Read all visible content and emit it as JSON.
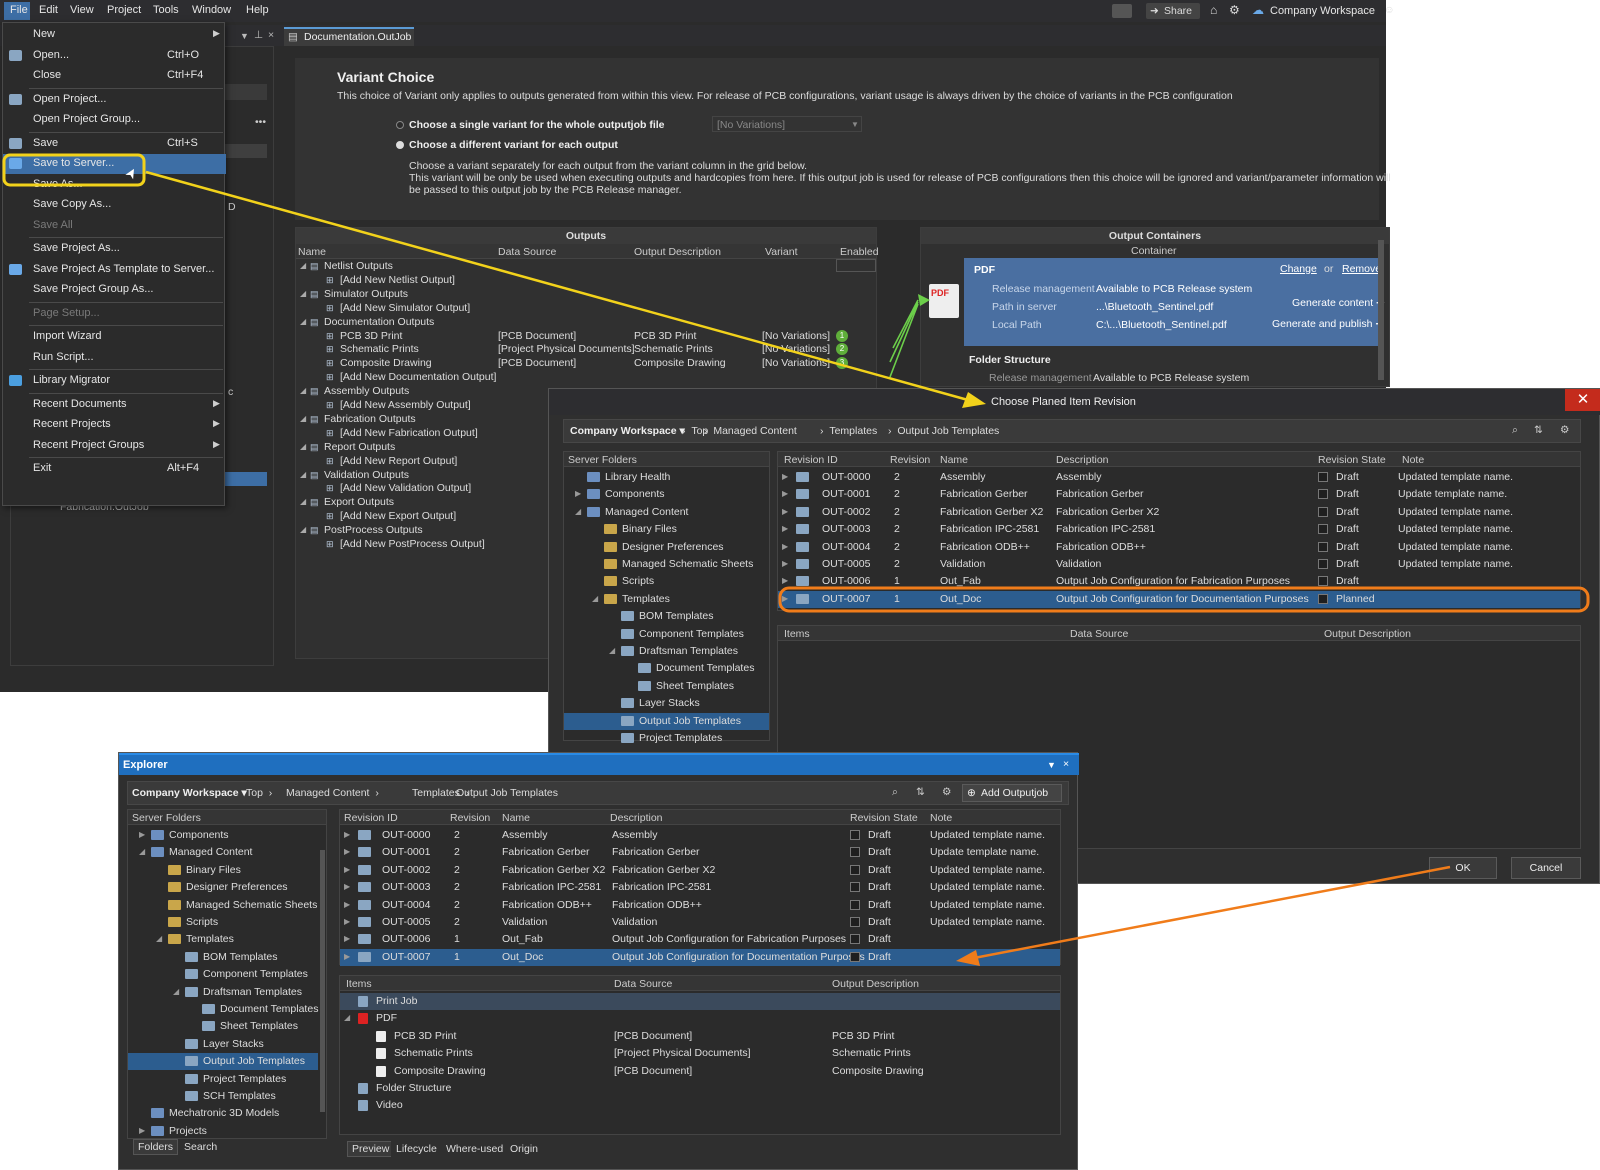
{
  "menubar": {
    "items": [
      "File",
      "Edit",
      "View",
      "Project",
      "Tools",
      "Window",
      "Help"
    ],
    "share": "Share",
    "workspace": "Company Workspace"
  },
  "doc_tab": "Documentation.OutJob",
  "file_menu": [
    {
      "label": "New",
      "shortcut": "",
      "sub": true
    },
    {
      "label": "Open...",
      "shortcut": "Ctrl+O"
    },
    {
      "label": "Close",
      "shortcut": "Ctrl+F4"
    },
    {
      "label": "Open Project...",
      "shortcut": ""
    },
    {
      "label": "Open Project Group...",
      "shortcut": ""
    },
    {
      "label": "Save",
      "shortcut": "Ctrl+S"
    },
    {
      "label": "Save to Server...",
      "shortcut": ""
    },
    {
      "label": "Save As...",
      "shortcut": ""
    },
    {
      "label": "Save Copy As...",
      "shortcut": ""
    },
    {
      "label": "Save All",
      "shortcut": "",
      "disabled": true
    },
    {
      "label": "Save Project As...",
      "shortcut": ""
    },
    {
      "label": "Save Project As Template to Server...",
      "shortcut": ""
    },
    {
      "label": "Save Project Group As...",
      "shortcut": ""
    },
    {
      "label": "Page Setup...",
      "shortcut": "",
      "disabled": true
    },
    {
      "label": "Import Wizard",
      "shortcut": ""
    },
    {
      "label": "Run Script...",
      "shortcut": ""
    },
    {
      "label": "Library Migrator",
      "shortcut": ""
    },
    {
      "label": "Recent Documents",
      "shortcut": "",
      "sub": true
    },
    {
      "label": "Recent Projects",
      "shortcut": "",
      "sub": true
    },
    {
      "label": "Recent Project Groups",
      "shortcut": "",
      "sub": true
    },
    {
      "label": "Exit",
      "shortcut": "Alt+F4"
    }
  ],
  "left_remnants": {
    "fab_outjob": "Fabrication.OutJob",
    "d_letter": "D",
    "c_letter": "c"
  },
  "variant": {
    "title": "Variant Choice",
    "desc": "This choice of Variant only applies to outputs generated from within this view. For release of PCB configurations, variant usage is always driven by the choice of variants in the PCB configuration",
    "opt1": "Choose a single variant for the whole outputjob file",
    "opt1_value": "[No Variations]",
    "opt2": "Choose a different variant for each output",
    "note1": "Choose a variant separately for each output from the variant column in the grid below.",
    "note2": "This variant will be only be used when executing outputs and hardcopies from here. If this output job is used for release of PCB configurations then this choice will be ignored and variant/parameter information will",
    "note3": "be passed to this output job by the PCB Release manager."
  },
  "outputs": {
    "title": "Outputs",
    "columns": [
      "Name",
      "Data Source",
      "Output Description",
      "Variant",
      "Enabled"
    ],
    "rows": [
      {
        "level": 0,
        "name": "Netlist Outputs"
      },
      {
        "level": 1,
        "name": "[Add New Netlist Output]"
      },
      {
        "level": 0,
        "name": "Simulator Outputs"
      },
      {
        "level": 1,
        "name": "[Add New Simulator Output]"
      },
      {
        "level": 0,
        "name": "Documentation Outputs"
      },
      {
        "level": 1,
        "name": "PCB 3D Print",
        "src": "[PCB Document]",
        "desc": "PCB 3D Print",
        "var": "[No Variations]",
        "num": "1"
      },
      {
        "level": 1,
        "name": "Schematic Prints",
        "src": "[Project Physical Documents]",
        "desc": "Schematic Prints",
        "var": "[No Variations]",
        "num": "2"
      },
      {
        "level": 1,
        "name": "Composite Drawing",
        "src": "[PCB Document]",
        "desc": "Composite Drawing",
        "var": "[No Variations]",
        "num": "3"
      },
      {
        "level": 1,
        "name": "[Add New Documentation Output]"
      },
      {
        "level": 0,
        "name": "Assembly Outputs"
      },
      {
        "level": 1,
        "name": "[Add New Assembly Output]"
      },
      {
        "level": 0,
        "name": "Fabrication Outputs"
      },
      {
        "level": 1,
        "name": "[Add New Fabrication Output]"
      },
      {
        "level": 0,
        "name": "Report Outputs"
      },
      {
        "level": 1,
        "name": "[Add New Report Output]"
      },
      {
        "level": 0,
        "name": "Validation Outputs"
      },
      {
        "level": 1,
        "name": "[Add New Validation Output]"
      },
      {
        "level": 0,
        "name": "Export Outputs"
      },
      {
        "level": 1,
        "name": "[Add New Export Output]"
      },
      {
        "level": 0,
        "name": "PostProcess Outputs"
      },
      {
        "level": 1,
        "name": "[Add New PostProcess Output]"
      }
    ]
  },
  "containers": {
    "title": "Output Containers",
    "col": "Container",
    "pdf": "PDF",
    "change": "Change",
    "or": "or",
    "remove": "Remove",
    "rm_label": "Release management",
    "rm_value": "Available to PCB Release system",
    "ps_label": "Path in server",
    "ps_value": "...\\Bluetooth_Sentinel.pdf",
    "lp_label": "Local Path",
    "lp_value": "C:\\...\\Bluetooth_Sentinel.pdf",
    "gen": "Generate content",
    "genpub": "Generate and publish",
    "folder": "Folder Structure",
    "frm_label": "Release management",
    "frm_value": "Available to PCB Release system"
  },
  "dialog": {
    "title": "Choose Planed Item Revision",
    "breadcrumb": [
      "Company Workspace",
      "Top",
      "Managed Content",
      "Templates",
      "Output Job Templates"
    ],
    "tree_header": "Server Folders",
    "tree": [
      {
        "label": "Library Health",
        "lvl": 1
      },
      {
        "label": "Components",
        "lvl": 1
      },
      {
        "label": "Managed Content",
        "lvl": 1
      },
      {
        "label": "Binary Files",
        "lvl": 2
      },
      {
        "label": "Designer Preferences",
        "lvl": 2
      },
      {
        "label": "Managed Schematic Sheets",
        "lvl": 2
      },
      {
        "label": "Scripts",
        "lvl": 2
      },
      {
        "label": "Templates",
        "lvl": 2
      },
      {
        "label": "BOM Templates",
        "lvl": 3
      },
      {
        "label": "Component Templates",
        "lvl": 3
      },
      {
        "label": "Draftsman Templates",
        "lvl": 3
      },
      {
        "label": "Document Templates",
        "lvl": 4
      },
      {
        "label": "Sheet Templates",
        "lvl": 4
      },
      {
        "label": "Layer Stacks",
        "lvl": 3
      },
      {
        "label": "Output Job Templates",
        "lvl": 3,
        "sel": true
      },
      {
        "label": "Project Templates",
        "lvl": 3
      }
    ],
    "columns": [
      "Revision ID",
      "Revision",
      "Name",
      "Description",
      "Revision State",
      "Note"
    ],
    "rows": [
      {
        "id": "OUT-0000",
        "rev": "2",
        "name": "Assembly",
        "desc": "Assembly",
        "state": "Draft",
        "note": "Updated template name."
      },
      {
        "id": "OUT-0001",
        "rev": "2",
        "name": "Fabrication Gerber",
        "desc": "Fabrication Gerber",
        "state": "Draft",
        "note": "Update template name."
      },
      {
        "id": "OUT-0002",
        "rev": "2",
        "name": "Fabrication Gerber X2",
        "desc": "Fabrication Gerber X2",
        "state": "Draft",
        "note": "Updated template name."
      },
      {
        "id": "OUT-0003",
        "rev": "2",
        "name": "Fabrication IPC-2581",
        "desc": "Fabrication IPC-2581",
        "state": "Draft",
        "note": "Updated template name."
      },
      {
        "id": "OUT-0004",
        "rev": "2",
        "name": "Fabrication ODB++",
        "desc": "Fabrication ODB++",
        "state": "Draft",
        "note": "Updated template name."
      },
      {
        "id": "OUT-0005",
        "rev": "2",
        "name": "Validation",
        "desc": "Validation",
        "state": "Draft",
        "note": "Updated template name."
      },
      {
        "id": "OUT-0006",
        "rev": "1",
        "name": "Out_Fab",
        "desc": "Output Job Configuration for Fabrication Purposes",
        "state": "Draft",
        "note": ""
      },
      {
        "id": "OUT-0007",
        "rev": "1",
        "name": "Out_Doc",
        "desc": "Output Job Configuration for Documentation Purposes",
        "state": "Planned",
        "note": "",
        "sel": true
      }
    ],
    "items_columns": [
      "Items",
      "Data Source",
      "Output Description"
    ],
    "ok": "OK",
    "cancel": "Cancel"
  },
  "explorer": {
    "title": "Explorer",
    "breadcrumb": [
      "Company Workspace",
      "Top",
      "Managed Content",
      "Templates",
      "Output Job Templates"
    ],
    "add_button": "Add Outputjob",
    "tree_header": "Server Folders",
    "tree": [
      {
        "label": "Components",
        "lvl": 1
      },
      {
        "label": "Managed Content",
        "lvl": 1
      },
      {
        "label": "Binary Files",
        "lvl": 2
      },
      {
        "label": "Designer Preferences",
        "lvl": 2
      },
      {
        "label": "Managed Schematic Sheets",
        "lvl": 2
      },
      {
        "label": "Scripts",
        "lvl": 2
      },
      {
        "label": "Templates",
        "lvl": 2
      },
      {
        "label": "BOM Templates",
        "lvl": 3
      },
      {
        "label": "Component Templates",
        "lvl": 3
      },
      {
        "label": "Draftsman Templates",
        "lvl": 3
      },
      {
        "label": "Document Templates",
        "lvl": 4
      },
      {
        "label": "Sheet Templates",
        "lvl": 4
      },
      {
        "label": "Layer Stacks",
        "lvl": 3
      },
      {
        "label": "Output Job Templates",
        "lvl": 3,
        "sel": true
      },
      {
        "label": "Project Templates",
        "lvl": 3
      },
      {
        "label": "SCH Templates",
        "lvl": 3
      },
      {
        "label": "Mechatronic 3D Models",
        "lvl": 1
      },
      {
        "label": "Projects",
        "lvl": 1
      }
    ],
    "columns": [
      "Revision ID",
      "Revision",
      "Name",
      "Description",
      "Revision State",
      "Note"
    ],
    "rows": [
      {
        "id": "OUT-0000",
        "rev": "2",
        "name": "Assembly",
        "desc": "Assembly",
        "state": "Draft",
        "note": "Updated template name."
      },
      {
        "id": "OUT-0001",
        "rev": "2",
        "name": "Fabrication Gerber",
        "desc": "Fabrication Gerber",
        "state": "Draft",
        "note": "Update template name."
      },
      {
        "id": "OUT-0002",
        "rev": "2",
        "name": "Fabrication Gerber X2",
        "desc": "Fabrication Gerber X2",
        "state": "Draft",
        "note": "Updated template name."
      },
      {
        "id": "OUT-0003",
        "rev": "2",
        "name": "Fabrication IPC-2581",
        "desc": "Fabrication IPC-2581",
        "state": "Draft",
        "note": "Updated template name."
      },
      {
        "id": "OUT-0004",
        "rev": "2",
        "name": "Fabrication ODB++",
        "desc": "Fabrication ODB++",
        "state": "Draft",
        "note": "Updated template name."
      },
      {
        "id": "OUT-0005",
        "rev": "2",
        "name": "Validation",
        "desc": "Validation",
        "state": "Draft",
        "note": "Updated template name."
      },
      {
        "id": "OUT-0006",
        "rev": "1",
        "name": "Out_Fab",
        "desc": "Output Job Configuration for Fabrication Purposes",
        "state": "Draft",
        "note": ""
      },
      {
        "id": "OUT-0007",
        "rev": "1",
        "name": "Out_Doc",
        "desc": "Output Job Configuration for Documentation Purposes",
        "state": "Draft",
        "note": "",
        "sel": true
      }
    ],
    "items_columns": [
      "Items",
      "Data Source",
      "Output Description"
    ],
    "items": [
      {
        "label": "Print Job",
        "lvl": 0,
        "sel": true
      },
      {
        "label": "PDF",
        "lvl": 0
      },
      {
        "label": "PCB 3D Print",
        "lvl": 1,
        "src": "[PCB Document]",
        "desc": "PCB 3D Print"
      },
      {
        "label": "Schematic Prints",
        "lvl": 1,
        "src": "[Project Physical Documents]",
        "desc": "Schematic Prints"
      },
      {
        "label": "Composite Drawing",
        "lvl": 1,
        "src": "[PCB Document]",
        "desc": "Composite Drawing"
      },
      {
        "label": "Folder Structure",
        "lvl": 0
      },
      {
        "label": "Video",
        "lvl": 0
      }
    ],
    "bottom_tabs": [
      "Preview",
      "Lifecycle",
      "Where-used",
      "Origin"
    ],
    "left_tabs": [
      "Folders",
      "Search"
    ]
  },
  "colors": {
    "highlight_yellow": "#f2d21b",
    "highlight_orange": "#f07c1a",
    "selection": "#2c5d8f",
    "pdf_panel": "#4a6fa1",
    "explorer_title": "#1f6fbf",
    "close_red": "#c42b1c"
  }
}
